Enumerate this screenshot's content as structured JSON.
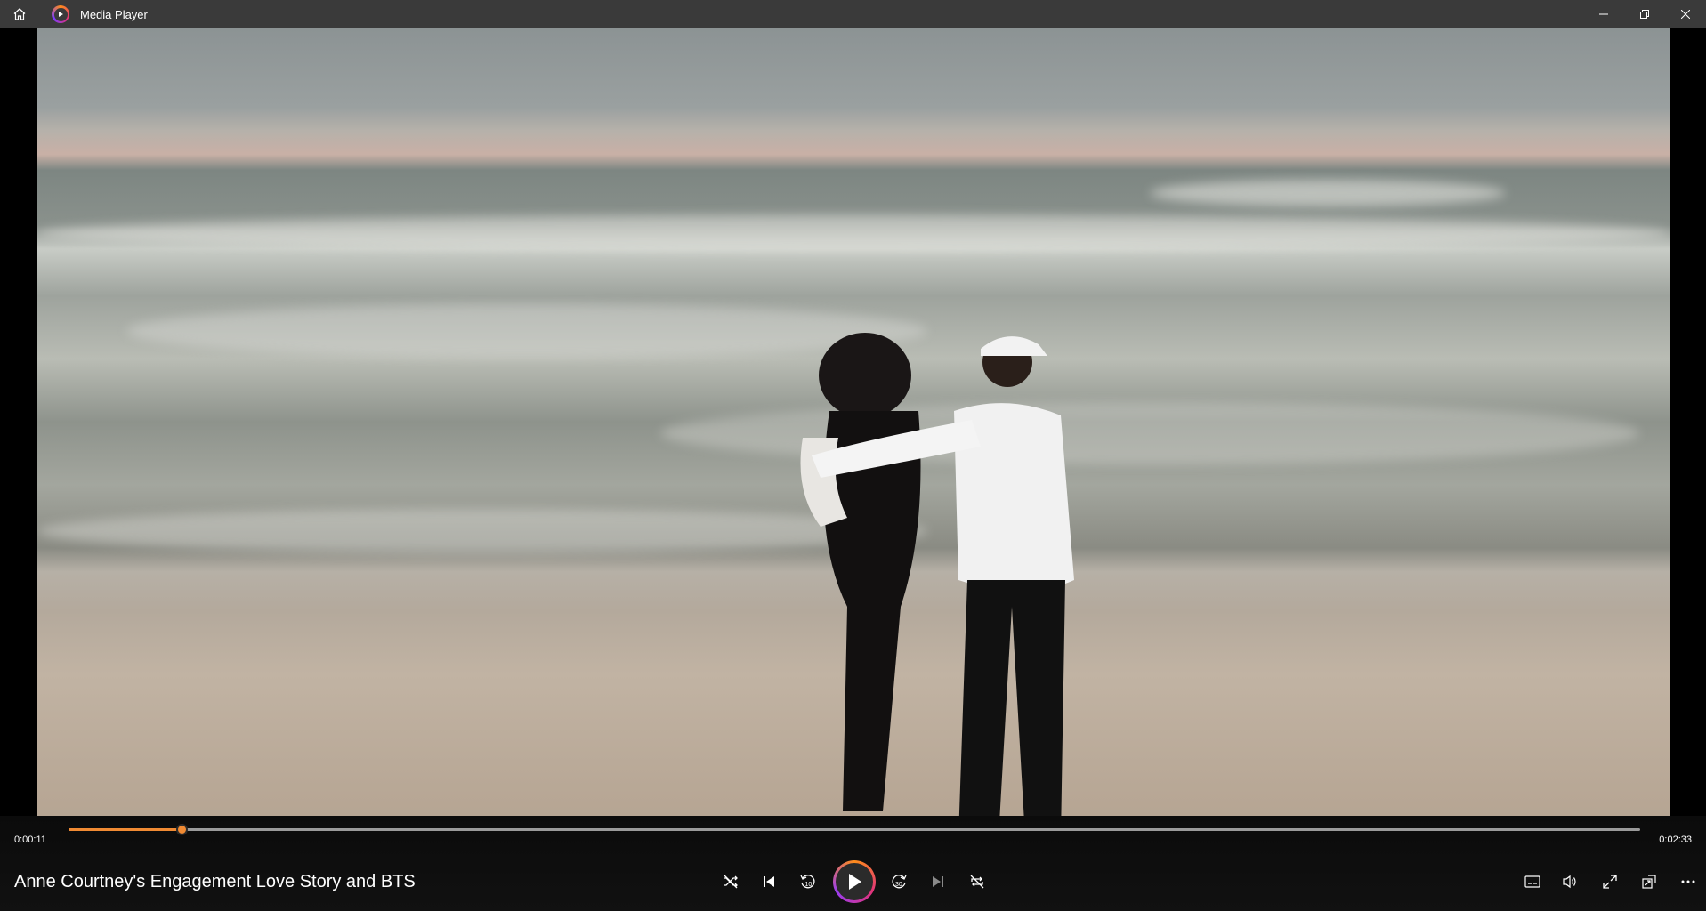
{
  "window": {
    "title": "Media Player",
    "home_icon": "home-icon",
    "app_icon": "media-player-logo-icon",
    "controls": [
      "minimize-icon",
      "restore-icon",
      "close-icon"
    ]
  },
  "player": {
    "current_time": "0:00:11",
    "total_time": "0:02:33",
    "progress_fraction": 0.072,
    "media_title": "Anne Courtney's Engagement Love Story and BTS",
    "accent_color": "#f08a33",
    "transport": [
      "shuffle-icon",
      "previous-icon",
      "rewind-10-icon",
      "play-icon",
      "forward-30-icon",
      "next-icon",
      "repeat-off-icon"
    ],
    "right_controls": [
      "subtitles-icon",
      "volume-icon",
      "fullscreen-icon",
      "mini-player-icon",
      "more-icon"
    ]
  }
}
